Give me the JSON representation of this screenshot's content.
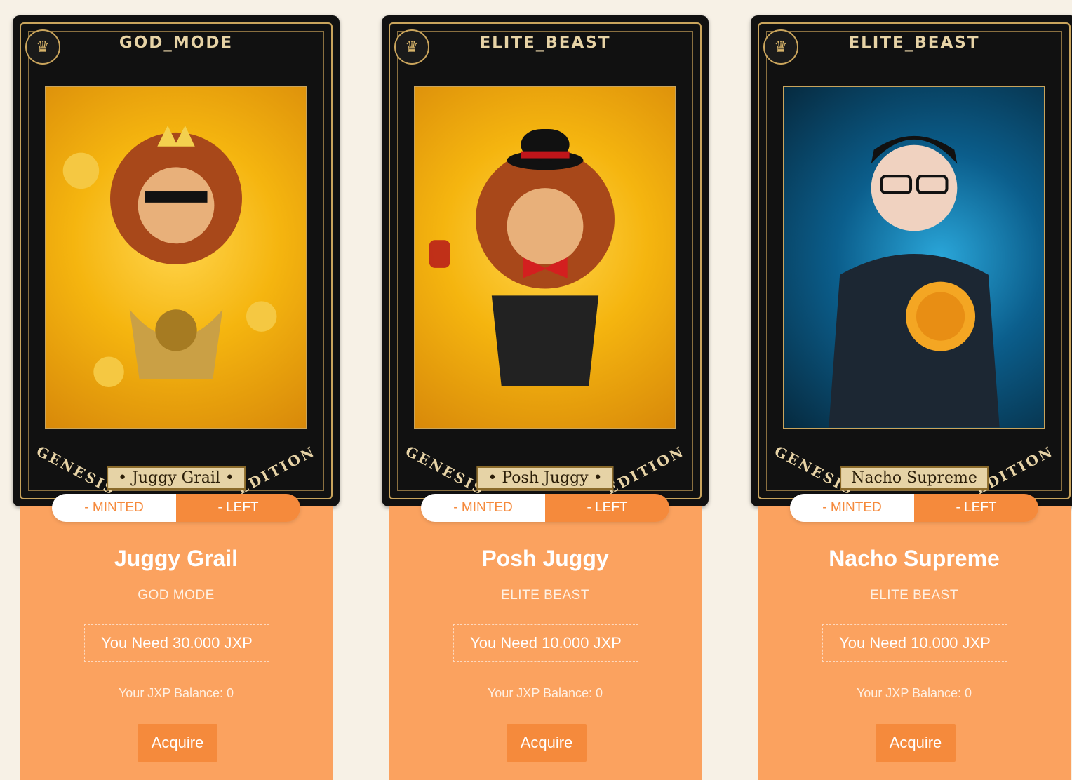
{
  "cards": [
    {
      "rank_banner": "GOD_MODE",
      "edition_left": "GENESIS",
      "edition_right": "EDITION",
      "plate": "• Juggy Grail •",
      "theme": "gold",
      "minted_label": "- MINTED",
      "left_label": "- LEFT",
      "name": "Juggy Grail",
      "category": "GOD MODE",
      "requirement": "You Need 30.000 JXP",
      "balance": "Your JXP Balance: 0",
      "button": "Acquire"
    },
    {
      "rank_banner": "ELITE_BEAST",
      "edition_left": "GENESIS",
      "edition_right": "EDITION",
      "plate": "• Posh Juggy •",
      "theme": "gold",
      "minted_label": "- MINTED",
      "left_label": "- LEFT",
      "name": "Posh Juggy",
      "category": "ELITE BEAST",
      "requirement": "You Need 10.000 JXP",
      "balance": "Your JXP Balance: 0",
      "button": "Acquire"
    },
    {
      "rank_banner": "ELITE_BEAST",
      "edition_left": "GENESIS",
      "edition_right": "EDITION",
      "plate": "Nacho Supreme",
      "theme": "tech",
      "minted_label": "- MINTED",
      "left_label": "- LEFT",
      "name": "Nacho Supreme",
      "category": "ELITE BEAST",
      "requirement": "You Need 10.000 JXP",
      "balance": "Your JXP Balance: 0",
      "button": "Acquire"
    }
  ],
  "colors": {
    "page_bg": "#f7f1e6",
    "panel": "#fba25f",
    "accent": "#f58a3c",
    "frame_gold": "#c9a45c"
  },
  "icons": {
    "badge": "lion-badge-icon"
  }
}
